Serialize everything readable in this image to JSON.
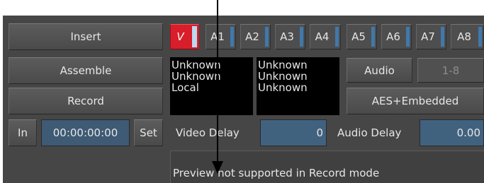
{
  "left_buttons": {
    "insert": "Insert",
    "assemble": "Assemble",
    "record": "Record"
  },
  "timecode": {
    "in_label": "In",
    "value": "00:00:00:00",
    "set_label": "Set"
  },
  "tracks": [
    {
      "label": "V"
    },
    {
      "label": "A1"
    },
    {
      "label": "A2"
    },
    {
      "label": "A3"
    },
    {
      "label": "A4"
    },
    {
      "label": "A5"
    },
    {
      "label": "A6"
    },
    {
      "label": "A7"
    },
    {
      "label": "A8"
    }
  ],
  "info_col1": [
    "Unknown",
    "Unknown",
    "Local"
  ],
  "info_col2": [
    "Unknown",
    "Unknown",
    "Unknown"
  ],
  "audio": {
    "label": "Audio",
    "range": "1-8",
    "format": "AES+Embedded"
  },
  "video_delay": {
    "label": "Video Delay",
    "value": "0"
  },
  "audio_delay": {
    "label": "Audio Delay",
    "value": "0.00"
  },
  "status_message": "Preview not supported in Record mode",
  "colors": {
    "panel": "#464646",
    "video_track": "#d81e2a",
    "field": "#41627f",
    "indicator": "#3f79ac"
  },
  "annotation": {
    "icon": "down-arrow"
  }
}
